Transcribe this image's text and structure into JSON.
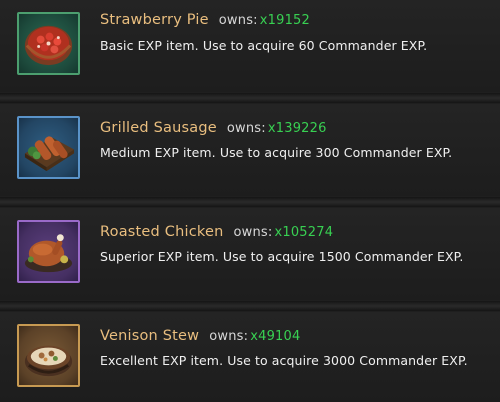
{
  "items": [
    {
      "name": "Strawberry Pie",
      "owns_label": "owns:",
      "owns_count": "x19152",
      "description": "Basic EXP item. Use to acquire 60 Commander EXP.",
      "rarity_color": "#4c9f6f",
      "icon": "strawberry-pie-icon"
    },
    {
      "name": "Grilled Sausage",
      "owns_label": "owns:",
      "owns_count": "x139226",
      "description": "Medium EXP item. Use to acquire 300 Commander EXP.",
      "rarity_color": "#5a93c9",
      "icon": "grilled-sausage-icon"
    },
    {
      "name": "Roasted Chicken",
      "owns_label": "owns:",
      "owns_count": "x105274",
      "description": "Superior EXP item. Use to acquire 1500 Commander EXP.",
      "rarity_color": "#9a6ac9",
      "icon": "roasted-chicken-icon"
    },
    {
      "name": "Venison Stew",
      "owns_label": "owns:",
      "owns_count": "x49104",
      "description": "Excellent EXP item. Use to acquire 3000 Commander EXP.",
      "rarity_color": "#c79a52",
      "icon": "venison-stew-icon"
    }
  ],
  "colors": {
    "name_text": "#e9be7f",
    "owns_count_text": "#38d052",
    "background": "#1f1f1f"
  }
}
